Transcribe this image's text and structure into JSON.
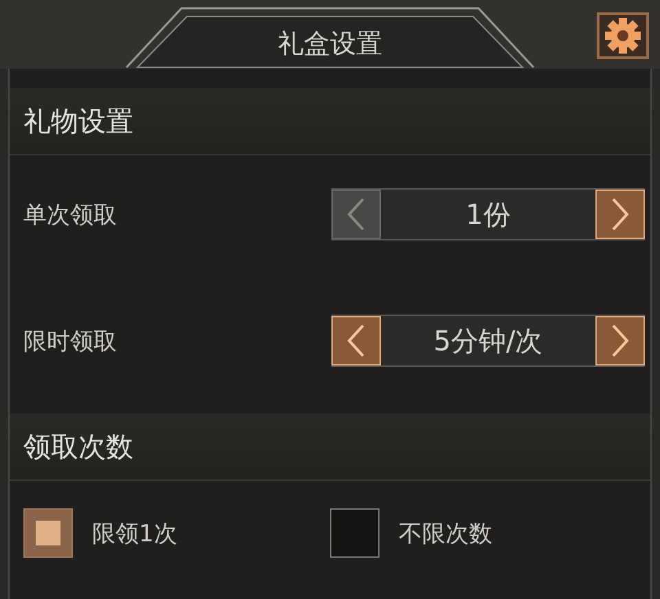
{
  "window": {
    "title": "礼盒设置"
  },
  "sections": [
    {
      "title": "礼物设置",
      "kind": "steppers",
      "rows": [
        {
          "label": "单次领取",
          "value": "1份",
          "prev_disabled": true,
          "next_disabled": false
        },
        {
          "label": "限时领取",
          "value": "5分钟/次",
          "prev_disabled": false,
          "next_disabled": false
        }
      ]
    },
    {
      "title": "领取次数",
      "kind": "options",
      "options": [
        {
          "label": "限领1次",
          "selected": true
        },
        {
          "label": "不限次数",
          "selected": false
        }
      ]
    }
  ]
}
